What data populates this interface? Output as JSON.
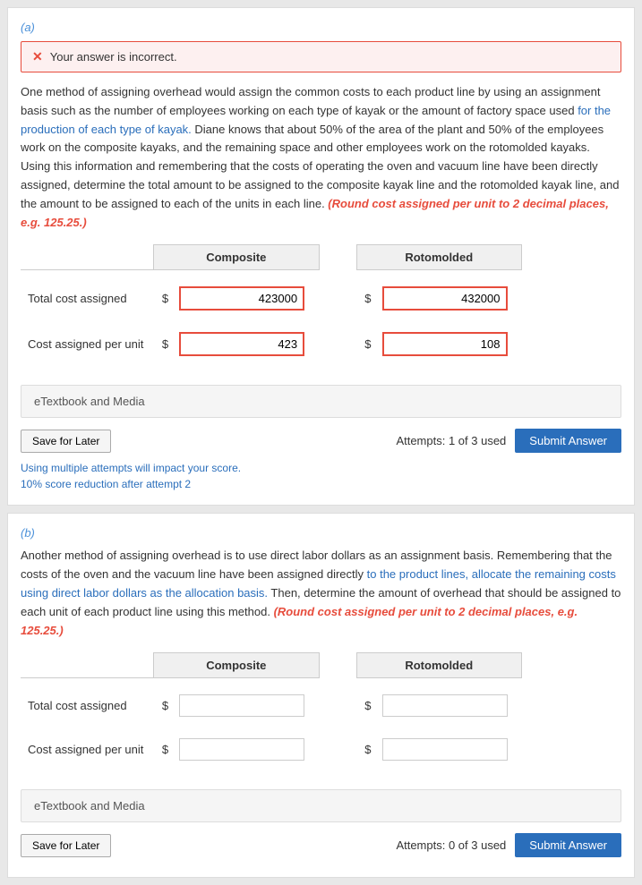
{
  "sectionA": {
    "label": "(a)",
    "error": {
      "icon": "✕",
      "text": "Your answer is incorrect."
    },
    "description_parts": [
      {
        "text": "One method of assigning overhead would assign the common costs to each product line by using an assignment basis such as the number of employees working on each type of kayak or the amount of factory space used ",
        "type": "normal"
      },
      {
        "text": "for the production of each type of kayak. Diane knows that about 50% of the area of the plant and 50% of the employees work on the composite kayaks, and the remaining space and other employees work on the rotomolded kayaks. Using this information and remembering that the costs of operating the oven and vacuum line have been directly assigned, determine the total amount to be assigned to the composite kayak line and the rotomolded kayak line, and the amount to be assigned to each of the units in each line. ",
        "type": "normal"
      },
      {
        "text": "(Round cost assigned per unit to 2 decimal places, e.g. 125.25.)",
        "type": "red"
      }
    ],
    "table": {
      "headers": [
        "",
        "Composite",
        "",
        "Rotomolded",
        ""
      ],
      "rows": [
        {
          "label": "Total cost assigned",
          "composite_currency": "$",
          "composite_value": "423000",
          "rotomolded_currency": "$",
          "rotomolded_value": "432000",
          "incorrect": true
        },
        {
          "label": "Cost assigned per unit",
          "composite_currency": "$",
          "composite_value": "423",
          "rotomolded_currency": "$",
          "rotomolded_value": "108",
          "incorrect": true
        }
      ]
    },
    "etextbook": "eTextbook and Media",
    "save_label": "Save for Later",
    "attempts_text": "Attempts: 1 of 3 used",
    "submit_label": "Submit Answer",
    "footer_note1": "Using multiple attempts will impact your score.",
    "footer_note2": "10% score reduction after attempt 2"
  },
  "sectionB": {
    "label": "(b)",
    "description_parts": [
      {
        "text": "Another method of assigning overhead is to use direct labor dollars as an assignment basis. Remembering that the costs of the oven and the vacuum line have been assigned directly ",
        "type": "normal"
      },
      {
        "text": "to the product lines, allocate the remaining costs using direct labor dollars as the allocation basis. Then, determine the amount of overhead that should be assigned to each unit of each product line using this method. ",
        "type": "normal"
      },
      {
        "text": "(Round cost assigned per unit to 2 decimal places, e.g. 125.25.)",
        "type": "red"
      }
    ],
    "table": {
      "rows": [
        {
          "label": "Total cost assigned",
          "composite_currency": "$",
          "composite_value": "",
          "rotomolded_currency": "$",
          "rotomolded_value": "",
          "incorrect": false
        },
        {
          "label": "Cost assigned per unit",
          "composite_currency": "$",
          "composite_value": "",
          "rotomolded_currency": "$",
          "rotomolded_value": "",
          "incorrect": false
        }
      ]
    },
    "etextbook": "eTextbook and Media",
    "save_label": "Save for Later",
    "attempts_text": "Attempts: 0 of 3 used",
    "submit_label": "Submit Answer"
  }
}
